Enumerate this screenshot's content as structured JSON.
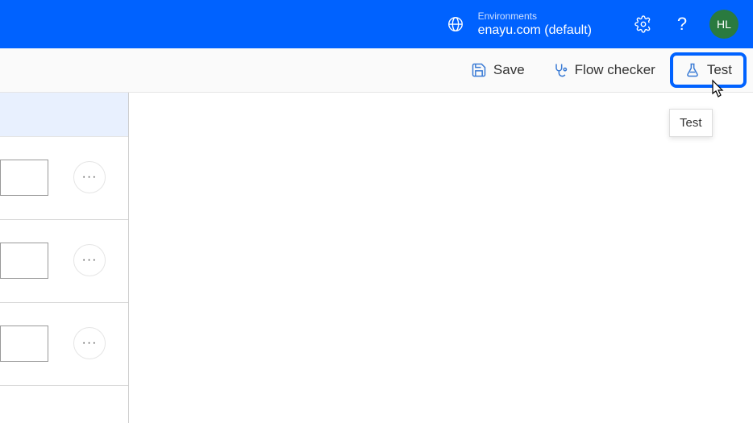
{
  "header": {
    "env_label": "Environments",
    "env_name": "enayu.com (default)",
    "avatar_initials": "HL"
  },
  "toolbar": {
    "save_label": "Save",
    "flow_checker_label": "Flow checker",
    "test_label": "Test"
  },
  "tooltip": {
    "test": "Test"
  },
  "canvas": {
    "rows": [
      {
        "ellipsis": "···"
      },
      {
        "ellipsis": "···"
      },
      {
        "ellipsis": "···"
      }
    ]
  },
  "colors": {
    "primary": "#0062ff",
    "avatar_bg": "#2a7a3f"
  }
}
